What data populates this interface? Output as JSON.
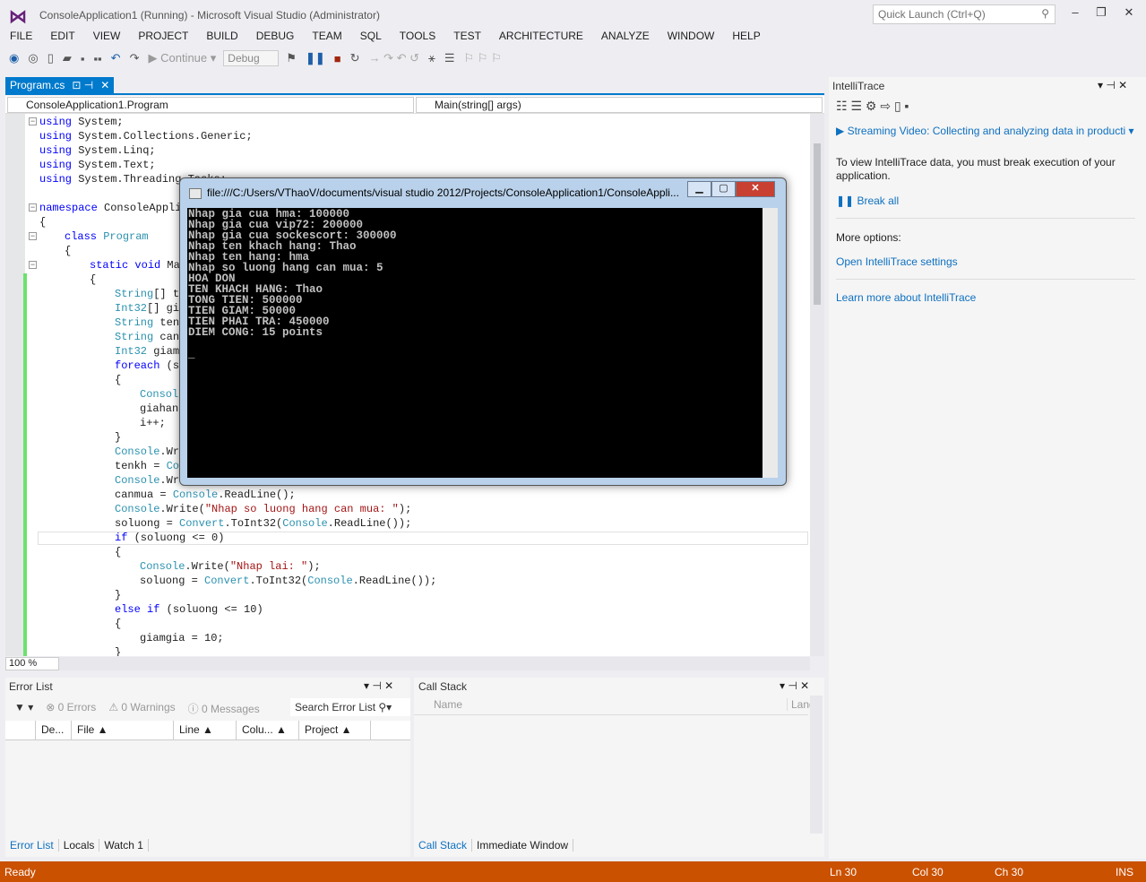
{
  "window": {
    "title": "ConsoleApplication1 (Running) - Microsoft Visual Studio (Administrator)",
    "quick_launch_placeholder": "Quick Launch (Ctrl+Q)"
  },
  "menu": [
    "FILE",
    "EDIT",
    "VIEW",
    "PROJECT",
    "BUILD",
    "DEBUG",
    "TEAM",
    "SQL",
    "TOOLS",
    "TEST",
    "ARCHITECTURE",
    "ANALYZE",
    "WINDOW",
    "HELP"
  ],
  "toolbar": {
    "continue_label": "Continue",
    "config_value": "Debug"
  },
  "editor": {
    "tab": "Program.cs",
    "class_dropdown": "ConsoleApplication1.Program",
    "member_dropdown": "Main(string[] args)",
    "zoom": "100 %",
    "lines": [
      [
        0,
        [
          [
            "using",
            "kw"
          ],
          [
            " System;",
            ""
          ]
        ]
      ],
      [
        0,
        [
          [
            "using",
            "kw"
          ],
          [
            " System.Collections.Generic;",
            ""
          ]
        ]
      ],
      [
        0,
        [
          [
            "using",
            "kw"
          ],
          [
            " System.Linq;",
            ""
          ]
        ]
      ],
      [
        0,
        [
          [
            "using",
            "kw"
          ],
          [
            " System.Text;",
            ""
          ]
        ]
      ],
      [
        0,
        [
          [
            "using",
            "kw"
          ],
          [
            " System.Threading.Tasks;",
            ""
          ]
        ]
      ],
      [
        0,
        []
      ],
      [
        0,
        [
          [
            "namespace",
            "kw"
          ],
          [
            " ConsoleAppli",
            ""
          ]
        ]
      ],
      [
        0,
        [
          [
            "{",
            ""
          ]
        ]
      ],
      [
        1,
        [
          [
            "class",
            "kw"
          ],
          [
            " ",
            ""
          ],
          [
            "Program",
            "ty"
          ]
        ]
      ],
      [
        1,
        [
          [
            "{",
            ""
          ]
        ]
      ],
      [
        2,
        [
          [
            "static",
            "kw"
          ],
          [
            " ",
            ""
          ],
          [
            "void",
            "kw"
          ],
          [
            " Ma",
            ""
          ]
        ]
      ],
      [
        2,
        [
          [
            "{",
            ""
          ]
        ]
      ],
      [
        3,
        [
          [
            "String",
            "ty"
          ],
          [
            "[] t",
            ""
          ]
        ]
      ],
      [
        3,
        [
          [
            "Int32",
            "ty"
          ],
          [
            "[] gi",
            ""
          ]
        ]
      ],
      [
        3,
        [
          [
            "String",
            "ty"
          ],
          [
            " ten",
            ""
          ]
        ]
      ],
      [
        3,
        [
          [
            "String",
            "ty"
          ],
          [
            " can",
            ""
          ]
        ]
      ],
      [
        3,
        [
          [
            "Int32",
            "ty"
          ],
          [
            " giam",
            ""
          ]
        ]
      ],
      [
        3,
        [
          [
            "foreach",
            "kw"
          ],
          [
            " (s",
            ""
          ]
        ]
      ],
      [
        3,
        [
          [
            "{",
            ""
          ]
        ]
      ],
      [
        4,
        [
          [
            "Consol",
            "ty"
          ]
        ]
      ],
      [
        4,
        [
          [
            "giahan",
            ""
          ]
        ]
      ],
      [
        4,
        [
          [
            "i++;",
            ""
          ]
        ]
      ],
      [
        3,
        [
          [
            "}",
            ""
          ]
        ]
      ],
      [
        3,
        [
          [
            "Console",
            "ty"
          ],
          [
            ".Wr",
            ""
          ]
        ]
      ],
      [
        3,
        [
          [
            "tenkh = ",
            ""
          ],
          [
            "Co",
            "ty"
          ]
        ]
      ],
      [
        3,
        [
          [
            "Console",
            "ty"
          ],
          [
            ".Wr",
            ""
          ]
        ]
      ],
      [
        3,
        [
          [
            "canmua = ",
            ""
          ],
          [
            "Console",
            "ty"
          ],
          [
            ".ReadLine();",
            ""
          ]
        ]
      ],
      [
        3,
        [
          [
            "Console",
            "ty"
          ],
          [
            ".Write(",
            ""
          ],
          [
            "\"Nhap so luong hang can mua: \"",
            "st"
          ],
          [
            ");",
            ""
          ]
        ]
      ],
      [
        3,
        [
          [
            "soluong = ",
            ""
          ],
          [
            "Convert",
            "ty"
          ],
          [
            ".ToInt32(",
            ""
          ],
          [
            "Console",
            "ty"
          ],
          [
            ".ReadLine());",
            ""
          ]
        ]
      ],
      [
        3,
        [
          [
            "if",
            "kw"
          ],
          [
            " (soluong <= 0)",
            ""
          ]
        ]
      ],
      [
        3,
        [
          [
            "{",
            ""
          ]
        ]
      ],
      [
        4,
        [
          [
            "Console",
            "ty"
          ],
          [
            ".Write(",
            ""
          ],
          [
            "\"Nhap lai: \"",
            "st"
          ],
          [
            ");",
            ""
          ]
        ]
      ],
      [
        4,
        [
          [
            "soluong = ",
            ""
          ],
          [
            "Convert",
            "ty"
          ],
          [
            ".ToInt32(",
            ""
          ],
          [
            "Console",
            "ty"
          ],
          [
            ".ReadLine());",
            ""
          ]
        ]
      ],
      [
        3,
        [
          [
            "}",
            ""
          ]
        ]
      ],
      [
        3,
        [
          [
            "else",
            "kw"
          ],
          [
            " ",
            ""
          ],
          [
            "if",
            "kw"
          ],
          [
            " (soluong <= 10)",
            ""
          ]
        ]
      ],
      [
        3,
        [
          [
            "{",
            ""
          ]
        ]
      ],
      [
        4,
        [
          [
            "giamgia = 10;",
            ""
          ]
        ]
      ],
      [
        3,
        [
          [
            "}",
            ""
          ]
        ]
      ]
    ]
  },
  "console": {
    "title": "file:///C:/Users/VThaoV/documents/visual studio 2012/Projects/ConsoleApplication1/ConsoleAppli...",
    "lines": [
      "Nhap gia cua hma: 100000",
      "Nhap gia cua vip72: 200000",
      "Nhap gia cua sockescort: 300000",
      "Nhap ten khach hang: Thao",
      "Nhap ten hang: hma",
      "Nhap so luong hang can mua: 5",
      "HOA DON",
      "TEN KHACH HANG: Thao",
      "TONG TIEN: 500000",
      "TIEN GIAM: 50000",
      "TIEN PHAI TRA: 450000",
      "DIEM CONG: 15 points",
      "",
      "_"
    ]
  },
  "intellitrace": {
    "title": "IntelliTrace",
    "video_link": "Streaming Video: Collecting and analyzing data in producti",
    "info": "To view IntelliTrace data, you must break execution of your application.",
    "break_all": "Break all",
    "more_options": "More options:",
    "settings_link": "Open IntelliTrace settings",
    "learn_link": "Learn more about IntelliTrace"
  },
  "error_list": {
    "title": "Error List",
    "errors": "0 Errors",
    "warnings": "0 Warnings",
    "messages": "0 Messages",
    "search_placeholder": "Search Error List",
    "columns": [
      "De...",
      "File ▲",
      "Line ▲",
      "Colu...   ▲",
      "Project ▲"
    ],
    "tabs": [
      "Error List",
      "Locals",
      "Watch 1"
    ]
  },
  "call_stack": {
    "title": "Call Stack",
    "columns": [
      "Name",
      "Lang"
    ],
    "tabs": [
      "Call Stack",
      "Immediate Window"
    ]
  },
  "status": {
    "text": "Ready",
    "ln": "Ln 30",
    "col": "Col 30",
    "ch": "Ch 30",
    "mode": "INS"
  },
  "colors": {
    "accent": "#007acc",
    "status_bar": "#ca5100",
    "keyword": "#0000ff",
    "type": "#2b91af",
    "string": "#a31515"
  }
}
